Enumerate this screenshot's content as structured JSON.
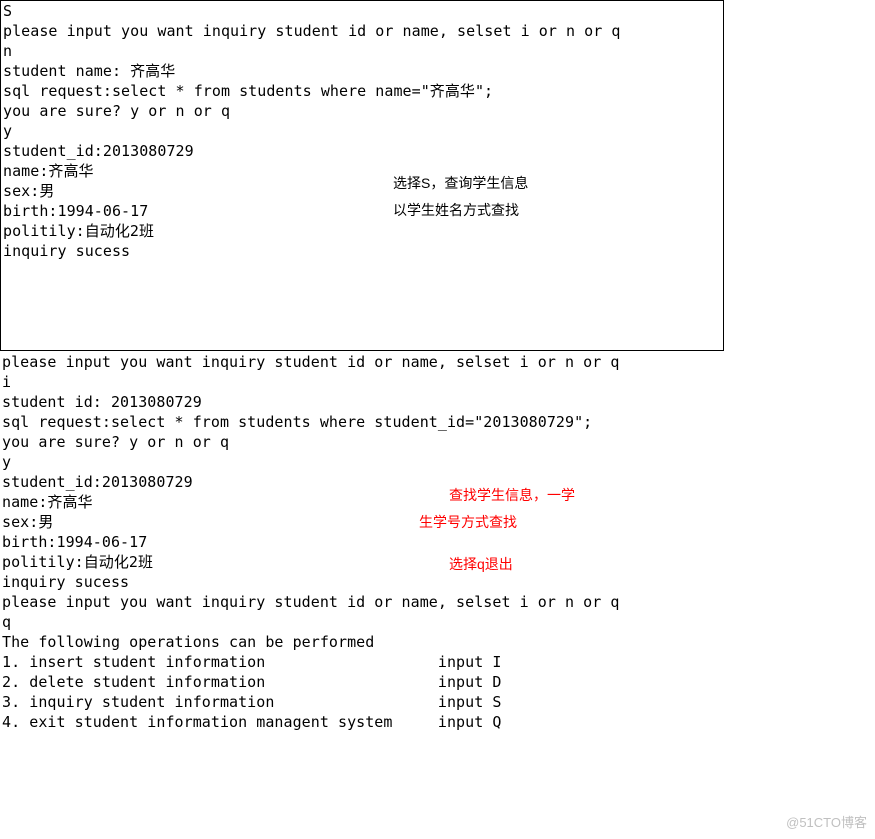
{
  "section1": {
    "lines": [
      "S",
      "please input you want inquiry student id or name, selset i or n or q",
      "n",
      "",
      "student name: 齐高华",
      "sql request:select * from students where name=\"齐高华\";",
      "",
      "you are sure? y or n or q",
      "y",
      "student_id:2013080729",
      "name:齐高华",
      "sex:男",
      "birth:1994-06-17",
      "politily:自动化2班",
      "",
      "inquiry sucess"
    ]
  },
  "section2": {
    "lines": [
      "please input you want inquiry student id or name, selset i or n or q",
      "i",
      "student id: 2013080729",
      "sql request:select * from students where student_id=\"2013080729\";",
      "",
      "you are sure? y or n or q",
      "y",
      "student_id:2013080729",
      "name:齐高华",
      "sex:男",
      "birth:1994-06-17",
      "politily:自动化2班",
      "",
      "inquiry sucess",
      "please input you want inquiry student id or name, selset i or n or q",
      "q",
      "The following operations can be performed",
      "1. insert student information                   input I",
      "2. delete student information                   input D",
      "3. inquiry student information                  input S",
      "4. exit student information managent system     input Q"
    ]
  },
  "annotations": {
    "a1": "选择S，查询学生信息",
    "a2": "以学生姓名方式查找",
    "a3": "查找学生信息，一学",
    "a4": "生学号方式查找",
    "a5": "选择q退出"
  },
  "watermark": "@51CTO博客"
}
